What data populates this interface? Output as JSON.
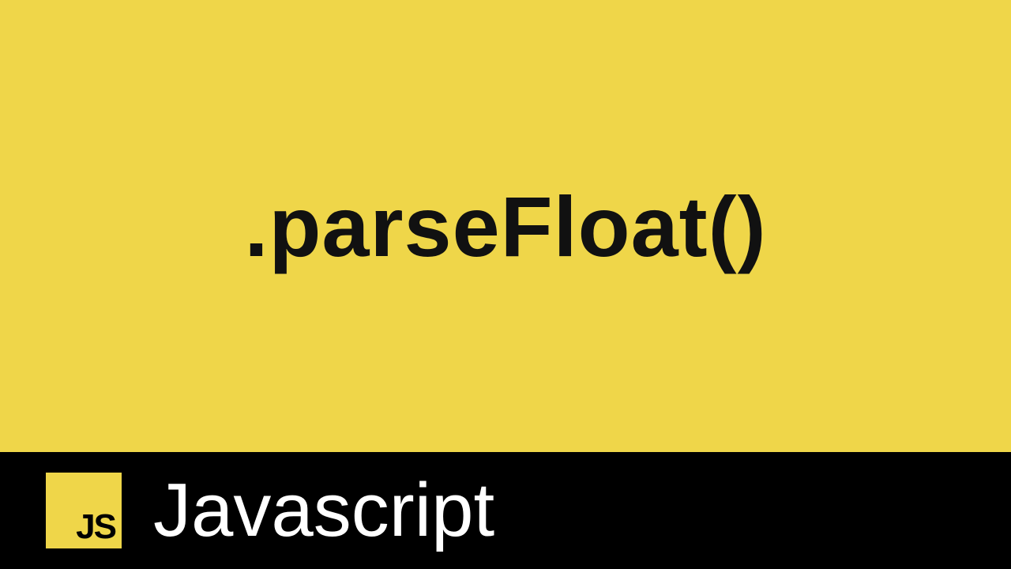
{
  "main": {
    "method_name": ".parseFloat()"
  },
  "footer": {
    "badge_text": "JS",
    "language_label": "Javascript"
  },
  "colors": {
    "yellow": "#efd649",
    "black": "#000000",
    "white": "#ffffff"
  }
}
